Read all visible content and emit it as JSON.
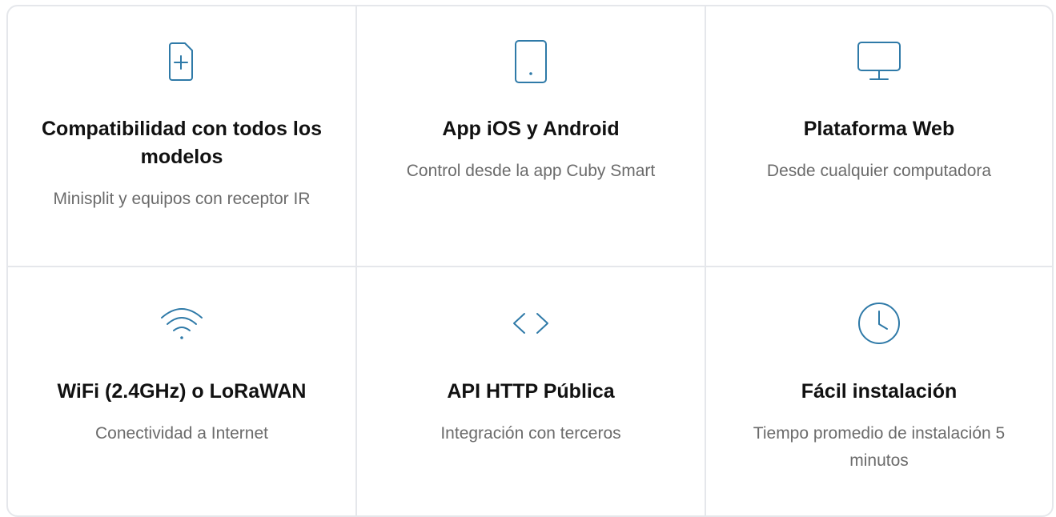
{
  "colors": {
    "accent": "#2f7aa8",
    "title": "#111111",
    "description": "#6b6b6b",
    "border": "#e5e7eb"
  },
  "features": [
    {
      "icon": "sim-card-plus-icon",
      "title": "Compatibilidad con todos los modelos",
      "description": "Minisplit y equipos con receptor IR"
    },
    {
      "icon": "tablet-icon",
      "title": "App iOS y Android",
      "description": "Control desde la app Cuby Smart"
    },
    {
      "icon": "monitor-icon",
      "title": "Plataforma Web",
      "description": "Desde cualquier computadora"
    },
    {
      "icon": "wifi-icon",
      "title": "WiFi (2.4GHz) o LoRaWAN",
      "description": "Conectividad a Internet"
    },
    {
      "icon": "code-icon",
      "title": "API HTTP Pública",
      "description": "Integración con terceros"
    },
    {
      "icon": "clock-icon",
      "title": "Fácil instalación",
      "description": "Tiempo promedio de instalación 5 minutos"
    }
  ]
}
